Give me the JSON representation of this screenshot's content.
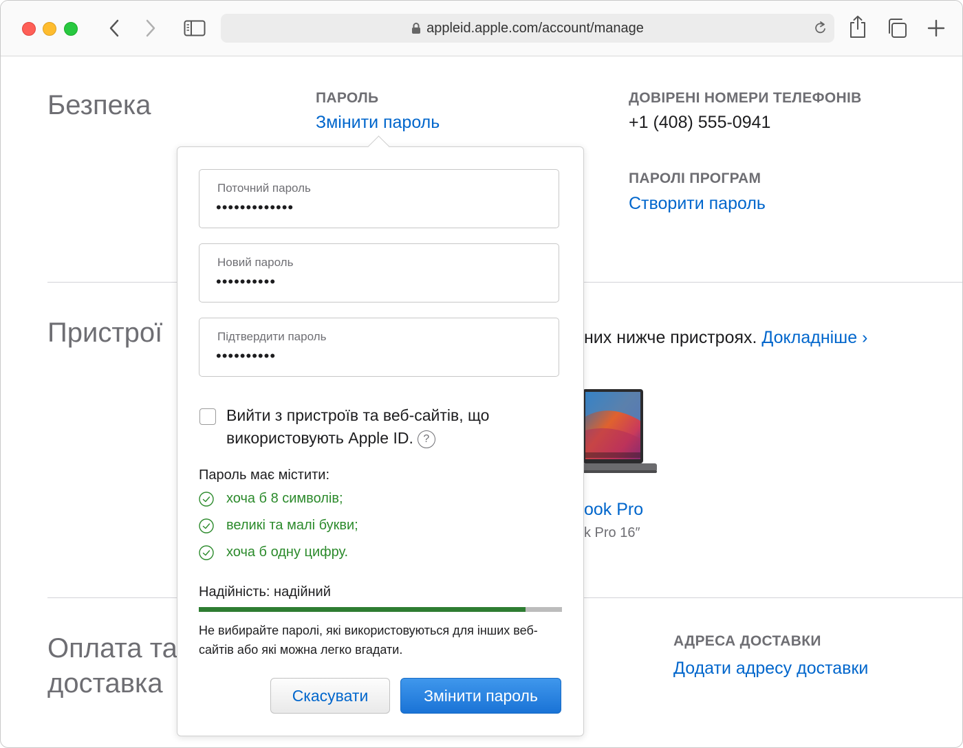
{
  "browser": {
    "url": "appleid.apple.com/account/manage"
  },
  "security": {
    "title": "Безпека",
    "password_label": "ПАРОЛЬ",
    "change_password_link": "Змінити пароль",
    "trusted_phones_label": "ДОВІРЕНІ НОМЕРИ ТЕЛЕФОНІВ",
    "phone_number": "+1 (408) 555-0941",
    "app_passwords_label": "ПАРОЛІ ПРОГРАМ",
    "create_password_link": "Створити пароль"
  },
  "devices": {
    "title": "Пристрої",
    "description_tail": "них нижче пристроях.",
    "learn_more_link": "Докладніше ›",
    "device_name_partial": "ook Pro",
    "device_model_partial": "k Pro 16″"
  },
  "payment": {
    "title_line1": "Оплата та",
    "title_line2": "доставка",
    "shipping_label": "АДРЕСА ДОСТАВКИ",
    "add_shipping_link": "Додати адресу доставки"
  },
  "change_password_popover": {
    "current_password_label": "Поточний пароль",
    "current_password_value": "•••••••••••••",
    "new_password_label": "Новий пароль",
    "new_password_value": "••••••••••",
    "confirm_password_label": "Підтвердити пароль",
    "confirm_password_value": "••••••••••",
    "sign_out_checkbox_label": "Вийти з пристроїв та веб-сайтів, що використовують Apple ID.",
    "sign_out_checked": false,
    "help_symbol": "?",
    "requirements_title": "Пароль має містити:",
    "requirements": [
      "хоча б 8 символів;",
      "великі та малі букви;",
      "хоча б одну цифру."
    ],
    "strength_text": "Надійність: надійний",
    "strength_fraction": 0.9,
    "hint": "Не вибирайте паролі, які використовуються для інших веб-сайтів або які можна легко вгадати.",
    "cancel_button": "Скасувати",
    "submit_button": "Змінити пароль"
  },
  "colors": {
    "link": "#0066cc",
    "success_green": "#2b8a2b",
    "strength_bar": "#2e7d32",
    "primary_button": "#1a73d6"
  },
  "icons": [
    "back-icon",
    "forward-icon",
    "sidebar-icon",
    "lock-icon",
    "reload-icon",
    "share-icon",
    "tabs-icon",
    "new-tab-icon",
    "checkmark-circle-icon",
    "help-icon"
  ]
}
